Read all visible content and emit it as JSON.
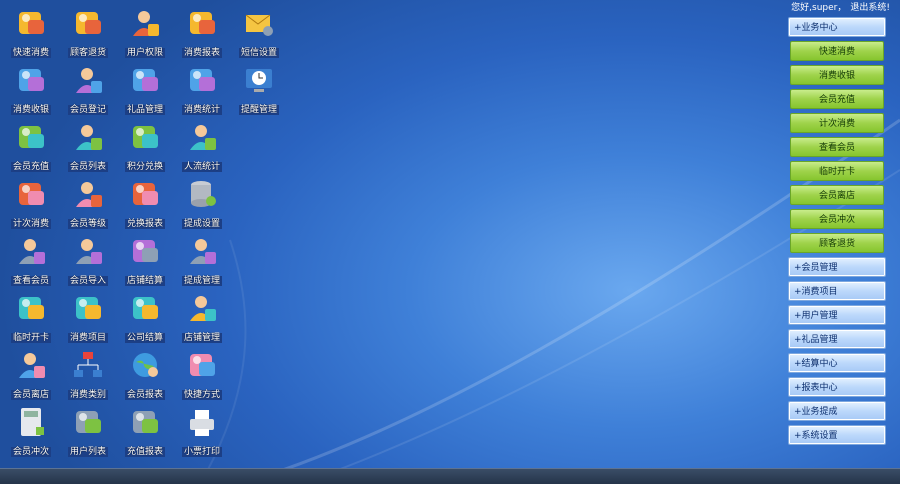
{
  "header": {
    "greeting": "您好,super，",
    "logout": "退出系统!"
  },
  "columns": [
    [
      {
        "label": "快速消费",
        "icon": "monitor-icon"
      },
      {
        "label": "消费收银",
        "icon": "cash-register-icon"
      },
      {
        "label": "会员充值",
        "icon": "coins-icon"
      },
      {
        "label": "计次消费",
        "icon": "register-icon"
      },
      {
        "label": "查看会员",
        "icon": "user-view-icon"
      },
      {
        "label": "临时开卡",
        "icon": "network-card-icon"
      },
      {
        "label": "会员离店",
        "icon": "globe-user-icon"
      },
      {
        "label": "会员冲次",
        "icon": "calculator-icon"
      }
    ],
    [
      {
        "label": "顾客退货",
        "icon": "return-arrow-icon"
      },
      {
        "label": "会员登记",
        "icon": "user-register-icon"
      },
      {
        "label": "会员列表",
        "icon": "user-list-icon"
      },
      {
        "label": "会员等级",
        "icon": "user-level-icon"
      },
      {
        "label": "会员导入",
        "icon": "user-import-icon"
      },
      {
        "label": "消费项目",
        "icon": "basket-icon"
      },
      {
        "label": "消费类别",
        "icon": "sitemap-icon"
      },
      {
        "label": "用户列表",
        "icon": "box-list-icon"
      }
    ],
    [
      {
        "label": "用户权限",
        "icon": "user-key-icon"
      },
      {
        "label": "礼品管理",
        "icon": "gift-icon"
      },
      {
        "label": "积分兑换",
        "icon": "exchange-icon"
      },
      {
        "label": "兑换报表",
        "icon": "report-chart-icon"
      },
      {
        "label": "店铺结算",
        "icon": "coins-stack-icon"
      },
      {
        "label": "公司结算",
        "icon": "blocks-icon"
      },
      {
        "label": "会员报表",
        "icon": "globe-report-icon"
      },
      {
        "label": "充值报表",
        "icon": "money-report-icon"
      }
    ],
    [
      {
        "label": "消费报表",
        "icon": "sheet-icon"
      },
      {
        "label": "消费统计",
        "icon": "statistics-icon"
      },
      {
        "label": "人流统计",
        "icon": "people-icon"
      },
      {
        "label": "提成设置",
        "icon": "database-icon"
      },
      {
        "label": "提成管理",
        "icon": "person-gold-icon"
      },
      {
        "label": "店铺管理",
        "icon": "shop-people-icon"
      },
      {
        "label": "快捷方式",
        "icon": "folder-shortcut-icon"
      },
      {
        "label": "小票打印",
        "icon": "printer-icon"
      }
    ],
    [
      {
        "label": "短信设置",
        "icon": "mail-gear-icon"
      },
      {
        "label": "提醒管理",
        "icon": "clock-screen-icon"
      }
    ]
  ],
  "menu": [
    {
      "label": "+业务中心",
      "style": "blue"
    },
    {
      "label": "快速消费",
      "style": "green"
    },
    {
      "label": "消费收银",
      "style": "green"
    },
    {
      "label": "会员充值",
      "style": "green"
    },
    {
      "label": "计次消费",
      "style": "green"
    },
    {
      "label": "查看会员",
      "style": "green"
    },
    {
      "label": "临时开卡",
      "style": "green"
    },
    {
      "label": "会员离店",
      "style": "green"
    },
    {
      "label": "会员冲次",
      "style": "green"
    },
    {
      "label": "顾客退货",
      "style": "green"
    },
    {
      "label": "+会员管理",
      "style": "blue"
    },
    {
      "label": "+消费项目",
      "style": "blue"
    },
    {
      "label": "+用户管理",
      "style": "blue"
    },
    {
      "label": "+礼品管理",
      "style": "blue"
    },
    {
      "label": "+结算中心",
      "style": "blue"
    },
    {
      "label": "+报表中心",
      "style": "blue"
    },
    {
      "label": "+业务提成",
      "style": "blue"
    },
    {
      "label": "+系统设置",
      "style": "blue"
    }
  ],
  "colors": {
    "background": "#2a63c0",
    "menu_green": "#9fd34b",
    "menu_blue": "#bcd8fb",
    "label_bg": "#1c3f86"
  }
}
